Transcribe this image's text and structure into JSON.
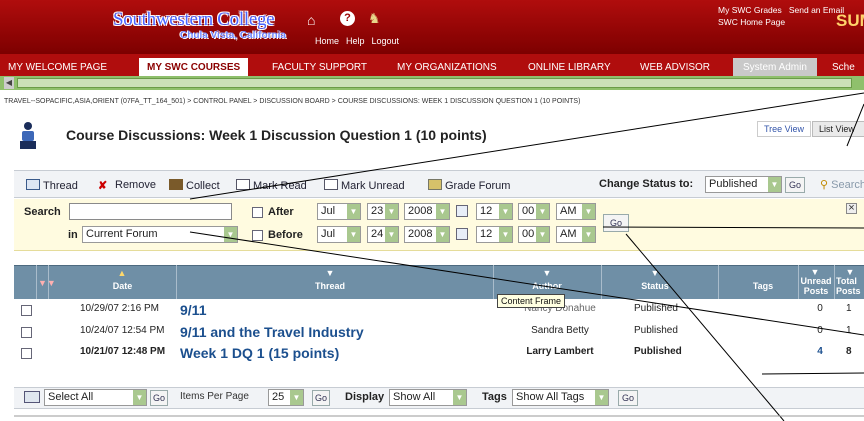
{
  "header": {
    "college_name": "Southwestern College",
    "college_location": "Chula Vista, California",
    "links": [
      "Home",
      "Help",
      "Logout"
    ],
    "top_right_links": [
      "My SWC Grades",
      "Send an Email",
      "SWC Home Page"
    ],
    "top_right_badge": "SUM"
  },
  "tabs": [
    "MY WELCOME PAGE",
    "MY SWC COURSES",
    "FACULTY SUPPORT",
    "MY ORGANIZATIONS",
    "ONLINE LIBRARY",
    "WEB ADVISOR",
    "System Admin",
    "Sche"
  ],
  "breadcrumb": "TRAVEL--SOPACIFIC,ASIA,ORIENT (07FA_TT_164_501) > CONTROL PANEL > DISCUSSION BOARD > COURSE DISCUSSIONS: WEEK 1 DISCUSSION QUESTION 1 (10 POINTS)",
  "page_title": "Course Discussions: Week 1 Discussion Question 1 (10 points)",
  "views": {
    "tree": "Tree View",
    "list": "List View"
  },
  "toolbar": {
    "thread": "Thread",
    "remove": "Remove",
    "collect": "Collect",
    "mark_read": "Mark Read",
    "mark_unread": "Mark Unread",
    "grade_forum": "Grade Forum",
    "change_status_label": "Change Status to:",
    "status_value": "Published",
    "go": "Go",
    "search": "Search"
  },
  "search": {
    "label": "Search",
    "in_label": "in",
    "scope": "Current Forum",
    "go": "Go",
    "after": {
      "label": "After",
      "month": "Jul",
      "day": "23",
      "year": "2008",
      "hour": "12",
      "minute": "00",
      "ampm": "AM"
    },
    "before": {
      "label": "Before",
      "month": "Jul",
      "day": "24",
      "year": "2008",
      "hour": "12",
      "minute": "00",
      "ampm": "AM"
    }
  },
  "table": {
    "headers": {
      "date": "Date",
      "thread": "Thread",
      "author": "Author",
      "status": "Status",
      "tags": "Tags",
      "unread_1": "Unread",
      "unread_2": "Posts",
      "total_1": "Total",
      "total_2": "Posts"
    },
    "rows": [
      {
        "date": "10/29/07 2:16 PM",
        "thread": "9/11",
        "author": "Nancy Donahue",
        "status": "Published",
        "unread": "0",
        "total": "1"
      },
      {
        "date": "10/24/07 12:54 PM",
        "thread": "9/11 and the Travel Industry",
        "author": "Sandra Betty",
        "status": "Published",
        "unread": "0",
        "total": "1"
      },
      {
        "date": "10/21/07 12:48 PM",
        "thread": "Week 1 DQ 1 (15 points)",
        "author": "Larry Lambert",
        "status": "Published",
        "unread": "4",
        "total": "8"
      }
    ],
    "tooltip": "Content Frame"
  },
  "bottom": {
    "select_all": "Select All",
    "go": "Go",
    "items_per_page_label": "Items Per Page",
    "items_per_page": "25",
    "display_label": "Display",
    "display_value": "Show All",
    "tags_label": "Tags",
    "tags_value": "Show All Tags"
  },
  "colors": {
    "header_red": "#9e0a0a",
    "table_head": "#6f8fa6",
    "thread_link": "#1b4f8e",
    "search_bg": "#fffbe0"
  }
}
